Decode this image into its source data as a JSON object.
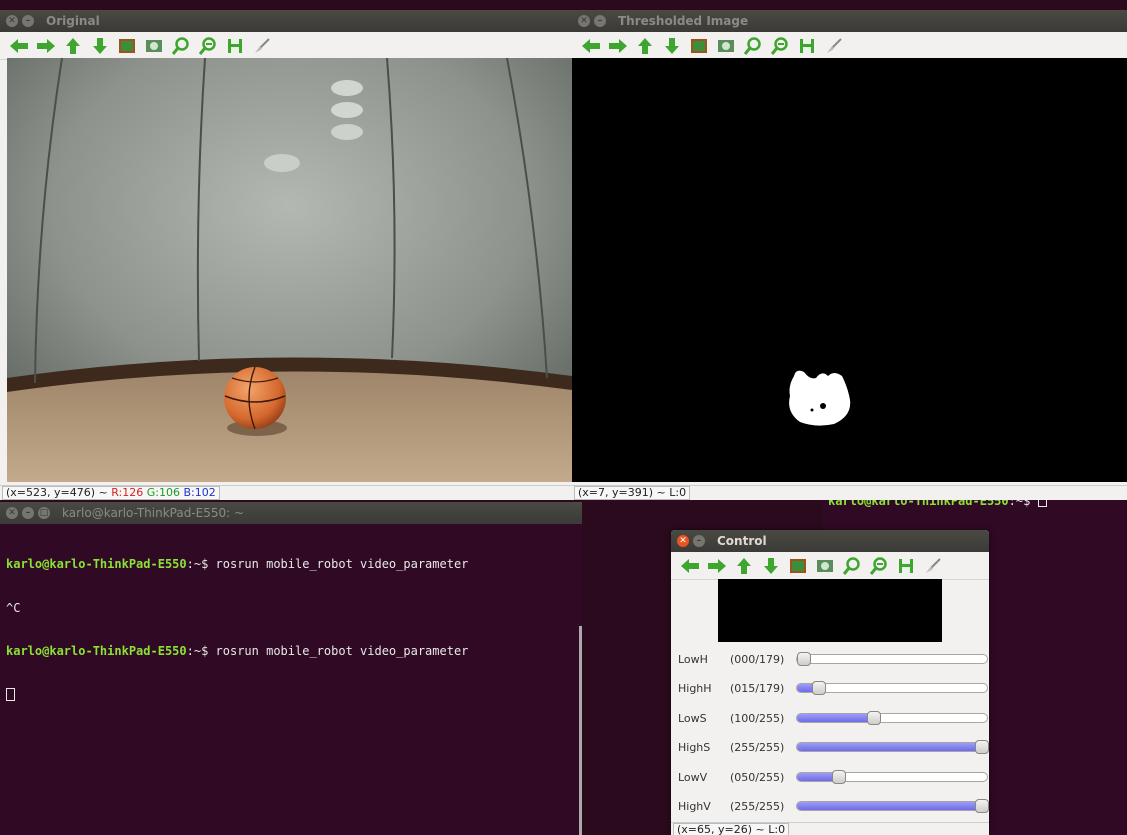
{
  "original_window": {
    "title": "Original",
    "status": {
      "coords": "(x=523, y=476) ~ ",
      "r": "R:126",
      "g": "G:106",
      "b": "B:102"
    }
  },
  "threshold_window": {
    "title": "Thresholded Image",
    "status": {
      "coords": "(x=7, y=391) ~ L:0"
    }
  },
  "background_terminal": {
    "prompt": "karlo@karlo-ThinkPad-E550",
    "suffix": ":~$ "
  },
  "terminal": {
    "title": "karlo@karlo-ThinkPad-E550: ~",
    "lines": [
      {
        "prompt": "karlo@karlo-ThinkPad-E550",
        "suffix": ":~$ ",
        "command": "rosrun mobile_robot video_parameter"
      },
      {
        "prompt": "",
        "suffix": "",
        "command": "^C"
      },
      {
        "prompt": "karlo@karlo-ThinkPad-E550",
        "suffix": ":~$ ",
        "command": "rosrun mobile_robot video_parameter"
      }
    ]
  },
  "control_window": {
    "title": "Control",
    "sliders": [
      {
        "name": "LowH",
        "value": "(000/179)",
        "fraction": 0.0
      },
      {
        "name": "HighH",
        "value": "(015/179)",
        "fraction": 0.084
      },
      {
        "name": "LowS",
        "value": "(100/255)",
        "fraction": 0.392
      },
      {
        "name": "HighS",
        "value": "(255/255)",
        "fraction": 1.0
      },
      {
        "name": "LowV",
        "value": "(050/255)",
        "fraction": 0.196
      },
      {
        "name": "HighV",
        "value": "(255/255)",
        "fraction": 1.0
      }
    ],
    "status": {
      "coords": "(x=65, y=26) ~ L:0"
    }
  },
  "toolbar_icons": [
    "arrow-left-icon",
    "arrow-right-icon",
    "arrow-up-icon",
    "arrow-down-icon",
    "fit-image-icon",
    "zoom-original-icon",
    "zoom-in-icon",
    "zoom-out-icon",
    "save-icon",
    "properties-icon"
  ],
  "colors": {
    "terminal_bg": "#300a24",
    "prompt_green": "#8ae234",
    "close_orange": "#e95420",
    "slider_fill": "#7b7af0"
  }
}
